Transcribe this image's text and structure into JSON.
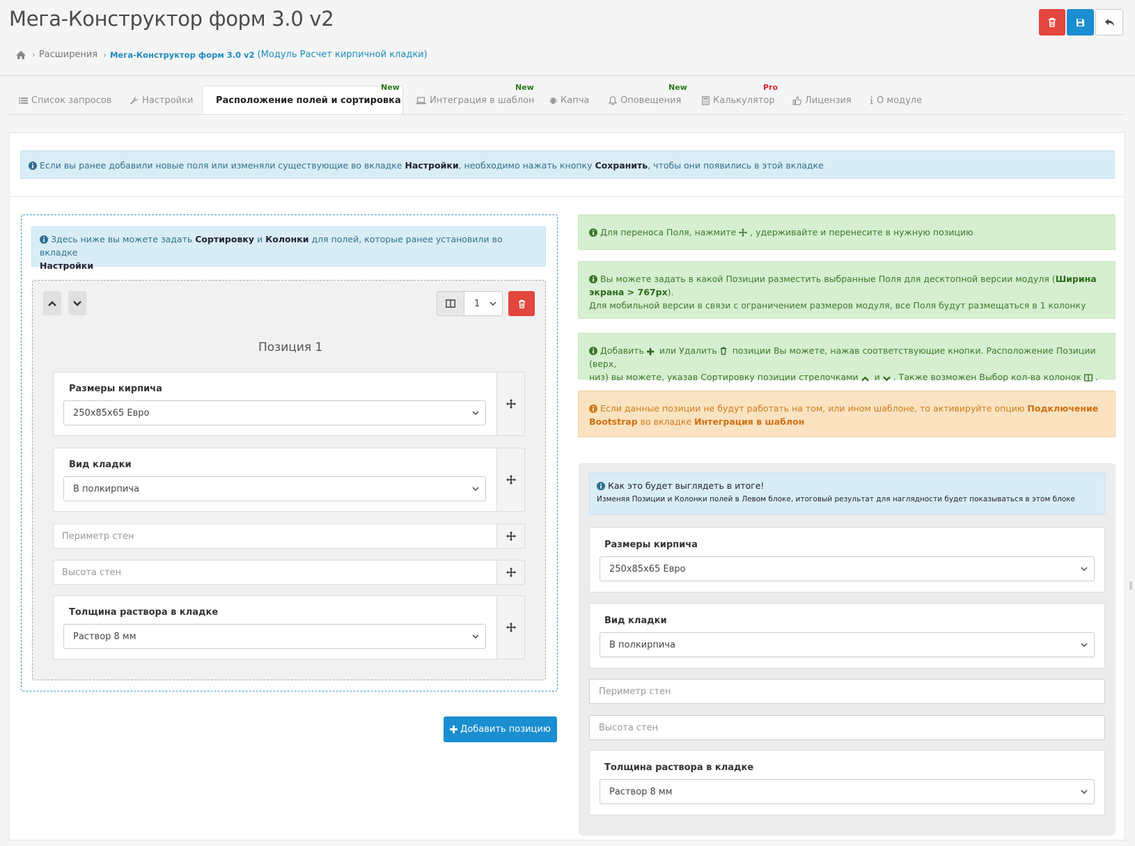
{
  "header": {
    "title": "Мега-Конструктор форм 3.0 v2",
    "buttons": {
      "delete": "trash-icon",
      "save": "save-icon",
      "back": "reply-icon"
    },
    "colors": {
      "danger": "#e3463d",
      "primary": "#1a8ed0"
    }
  },
  "breadcrumb": {
    "home_icon": "home-icon",
    "item1": "Расширения",
    "item2_bold": "Мега-Конструктор форм 3.0 v2",
    "item2_rest": "(Модуль Расчет кирпичной кладки)"
  },
  "tabs": [
    {
      "label": "Список запросов",
      "icon": "list-icon",
      "badge": ""
    },
    {
      "label": "Настройки",
      "icon": "wrench-icon",
      "badge": ""
    },
    {
      "label": "Расположение полей и сортировка",
      "icon": "list-icon",
      "badge": "New",
      "active": true
    },
    {
      "label": "Интеграция в шаблон",
      "icon": "laptop-icon",
      "badge": "New"
    },
    {
      "label": "Капча",
      "icon": "bug-icon",
      "badge": ""
    },
    {
      "label": "Оповещения",
      "icon": "bell-icon",
      "badge": "New"
    },
    {
      "label": "Калькулятор",
      "icon": "calculator-icon",
      "badge": "Pro"
    },
    {
      "label": "Лицензия",
      "icon": "thumbs-up-icon",
      "badge": ""
    },
    {
      "label": "О модуле",
      "icon": "info-icon",
      "badge": ""
    }
  ],
  "top_alert": {
    "t1": "Если вы ранее добавили новые поля или изменяли существующие во вкладке ",
    "b1": "Настройки",
    "t2": ", необходимо нажать кнопку ",
    "b2": "Сохранить",
    "t3": ", чтобы они появились в этой вкладке"
  },
  "left": {
    "alert": {
      "t1": "Здесь ниже вы можете задать ",
      "b1": "Сортировку",
      "t2": " и ",
      "b2": "Колонки",
      "t3": " для полей, которые ранее установили во вкладке",
      "b3": "Настройки"
    },
    "columns_value": "1",
    "position_label": "Позиция 1",
    "fields": [
      {
        "type": "select",
        "label": "Размеры кирпича",
        "value": "250х85х65 Евро"
      },
      {
        "type": "select",
        "label": "Вид кладки",
        "value": "В полкирпича"
      },
      {
        "type": "input",
        "placeholder": "Периметр стен"
      },
      {
        "type": "input",
        "placeholder": "Высота стен"
      },
      {
        "type": "select",
        "label": "Толщина раствора в кладке",
        "value": "Раствор 8 мм"
      }
    ],
    "add_button": "Добавить позицию"
  },
  "right": {
    "alert1": {
      "t1": "Для переноса Поля, нажмите ",
      "t2": ", удерживайте и перенесите в нужную позицию"
    },
    "alert2": {
      "t1": "Вы можете задать в какой Позиции разместить выбранные Поля для десктопной версии модуля (",
      "b1a": "Ширина",
      "b1b": "экрана > 767px",
      "t2": ").",
      "t3": "Для мобильной версии в связи с ограничением размеров модуля, все Поля будут размещаться в 1 колонку"
    },
    "alert3": {
      "t1": "Добавить ",
      "t2": " или Удалить ",
      "t3": " позиции Вы можете, нажав соответствующие кнопки. Расположение Позиции (верх,",
      "t4": "низ) вы можете, указав Сортировку позиции стрелочками ",
      "t5": " и ",
      "t6": ". Также возможен Выбор кол-ва колонок "
    },
    "alert4": {
      "t1": "Если данные позиции не будут работать на том, или ином шаблоне, то активируйте опцию ",
      "b1a": "Подключение",
      "b1b": "Bootstrap",
      "t2": " во вкладке ",
      "b2": "Интеграция в шаблон"
    },
    "preview": {
      "title": "Как это будет выглядеть в итоге!",
      "subtitle": "Изменяя Позиции и Колонки полей в Левом блоке, итоговый результат для наглядности будет показываться в этом блоке",
      "fields": [
        {
          "type": "select",
          "label": "Размеры кирпича",
          "value": "250х85х65 Евро"
        },
        {
          "type": "select",
          "label": "Вид кладки",
          "value": "В полкирпича"
        },
        {
          "type": "input",
          "placeholder": "Периметр стен"
        },
        {
          "type": "input",
          "placeholder": "Высота стен"
        },
        {
          "type": "select",
          "label": "Толщина раствора в кладке",
          "value": "Раствор 8 мм"
        }
      ]
    }
  }
}
